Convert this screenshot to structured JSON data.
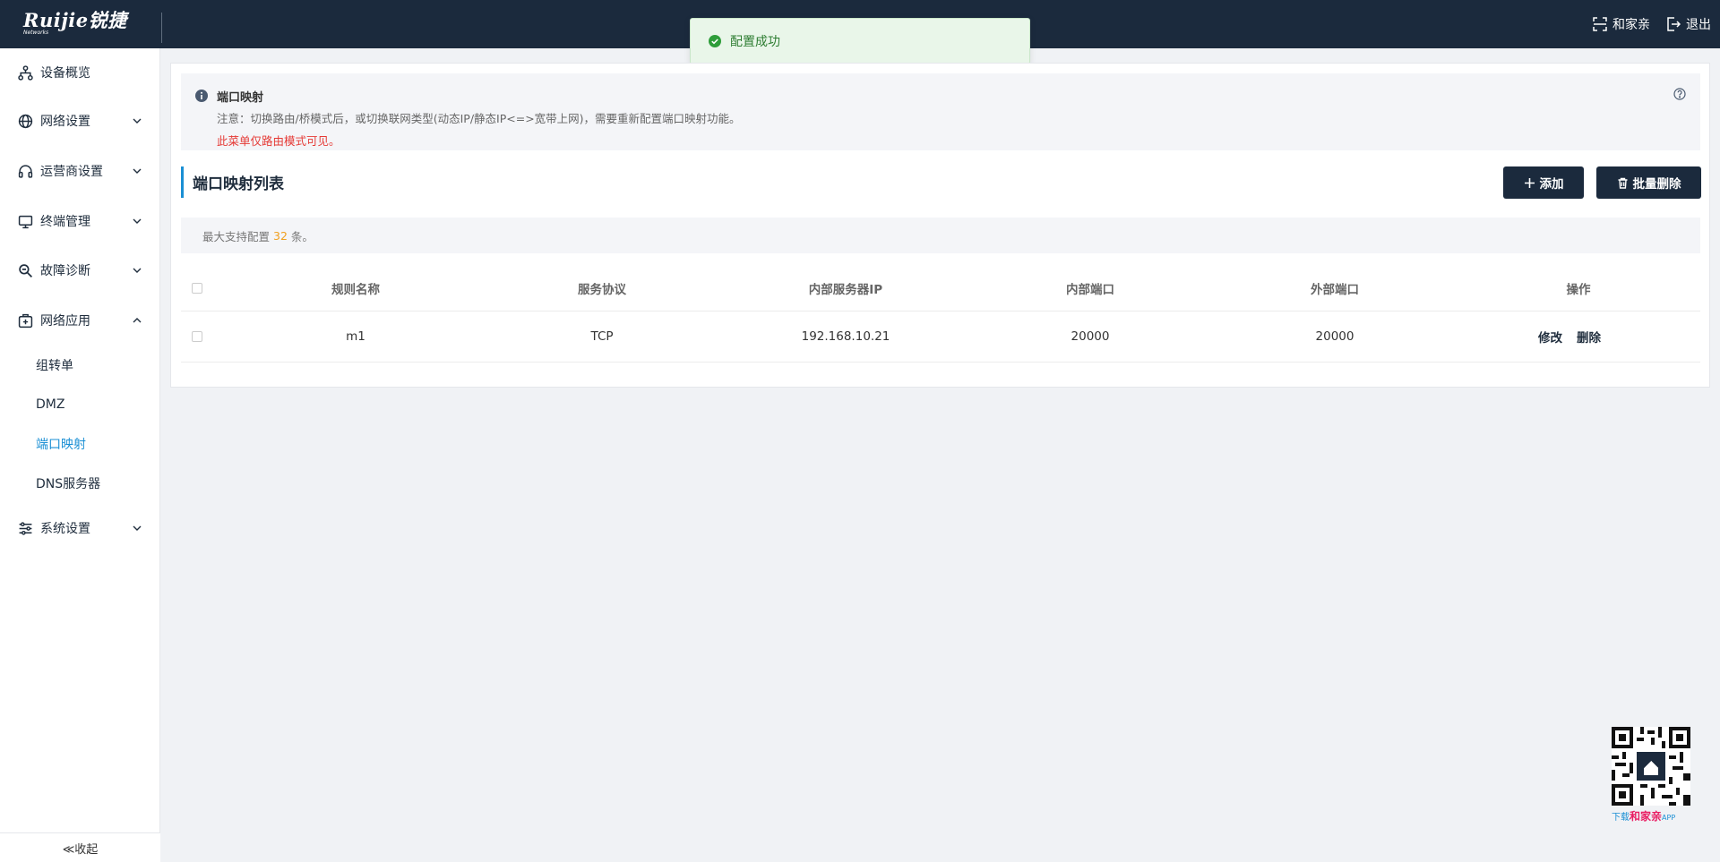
{
  "header": {
    "logo": "Ruijie锐捷",
    "logo_sub": "Networks",
    "app_label": "和家亲",
    "logout_label": "退出"
  },
  "toast": {
    "text": "配置成功"
  },
  "sidebar": {
    "items": [
      {
        "label": "设备概览",
        "icon": "topology-icon"
      },
      {
        "label": "网络设置",
        "icon": "globe-icon"
      },
      {
        "label": "运营商设置",
        "icon": "headset-icon"
      },
      {
        "label": "终端管理",
        "icon": "monitor-icon"
      },
      {
        "label": "故障诊断",
        "icon": "diagnose-icon"
      },
      {
        "label": "网络应用",
        "icon": "app-icon"
      },
      {
        "label": "系统设置",
        "icon": "sliders-icon"
      }
    ],
    "sub_items": [
      {
        "label": "组转单"
      },
      {
        "label": "DMZ"
      },
      {
        "label": "端口映射",
        "active": true
      },
      {
        "label": "DNS服务器"
      }
    ],
    "collapse_label": "≪收起"
  },
  "notice": {
    "title": "端口映射",
    "line1": "注意：切换路由/桥模式后，或切换联网类型(动态IP/静态IP<=>宽带上网)，需要重新配置端口映射功能。",
    "line2": "此菜单仅路由模式可见。"
  },
  "section": {
    "title": "端口映射列表",
    "add_label": "添加",
    "batch_delete_label": "批量删除"
  },
  "info": {
    "prefix": "最大支持配置",
    "count": "32",
    "suffix": "条。"
  },
  "table": {
    "headers": [
      "规则名称",
      "服务协议",
      "内部服务器IP",
      "内部端口",
      "外部端口",
      "操作"
    ],
    "rows": [
      {
        "name": "m1",
        "protocol": "TCP",
        "ip": "192.168.10.21",
        "internal_port": "20000",
        "external_port": "20000",
        "edit": "修改",
        "delete": "删除"
      }
    ]
  },
  "qr": {
    "cap_a": "下载",
    "cap_b": "和家亲",
    "cap_c": "APP"
  },
  "colors": {
    "header_bg": "#1b2a3d",
    "accent": "#1a8fd4",
    "warn": "#e53935",
    "count": "#f0a020"
  }
}
